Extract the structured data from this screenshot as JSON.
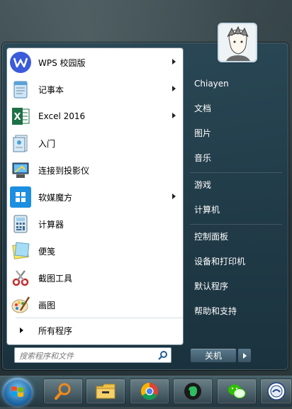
{
  "start_menu": {
    "programs": [
      {
        "label": "WPS 校园版",
        "icon": "wps-icon",
        "has_submenu": true
      },
      {
        "label": "记事本",
        "icon": "notepad-icon",
        "has_submenu": true
      },
      {
        "label": "Excel 2016",
        "icon": "excel-icon",
        "has_submenu": true
      },
      {
        "label": "入门",
        "icon": "getting-started-icon",
        "has_submenu": false
      },
      {
        "label": "连接到投影仪",
        "icon": "projector-icon",
        "has_submenu": false
      },
      {
        "label": "软媒魔方",
        "icon": "cube-icon",
        "has_submenu": true
      },
      {
        "label": "计算器",
        "icon": "calculator-icon",
        "has_submenu": false
      },
      {
        "label": "便笺",
        "icon": "sticky-notes-icon",
        "has_submenu": false
      },
      {
        "label": "截图工具",
        "icon": "snipping-tool-icon",
        "has_submenu": false
      },
      {
        "label": "画图",
        "icon": "paint-icon",
        "has_submenu": false
      }
    ],
    "all_programs_label": "所有程序",
    "search": {
      "placeholder": "搜索程序和文件",
      "value": ""
    },
    "right_links": [
      {
        "label": "Chiayen"
      },
      {
        "label": "文档"
      },
      {
        "label": "图片"
      },
      {
        "label": "音乐"
      },
      {
        "label": "游戏"
      },
      {
        "label": "计算机"
      },
      {
        "label": "控制面板"
      },
      {
        "label": "设备和打印机"
      },
      {
        "label": "默认程序"
      },
      {
        "label": "帮助和支持"
      }
    ],
    "shutdown_label": "关机"
  },
  "taskbar": {
    "items": [
      {
        "name": "start-orb-icon"
      },
      {
        "name": "search-tool-icon"
      },
      {
        "name": "file-explorer-icon"
      },
      {
        "name": "chrome-icon"
      },
      {
        "name": "evernote-icon"
      },
      {
        "name": "wechat-icon"
      },
      {
        "name": "app-icon"
      }
    ]
  },
  "colors": {
    "accent": "#1f6aa8",
    "wps": "#3b5bdb",
    "excel": "#1e7145",
    "chrome_red": "#db4437",
    "evernote": "#2dbe60",
    "wechat": "#2ec100"
  }
}
